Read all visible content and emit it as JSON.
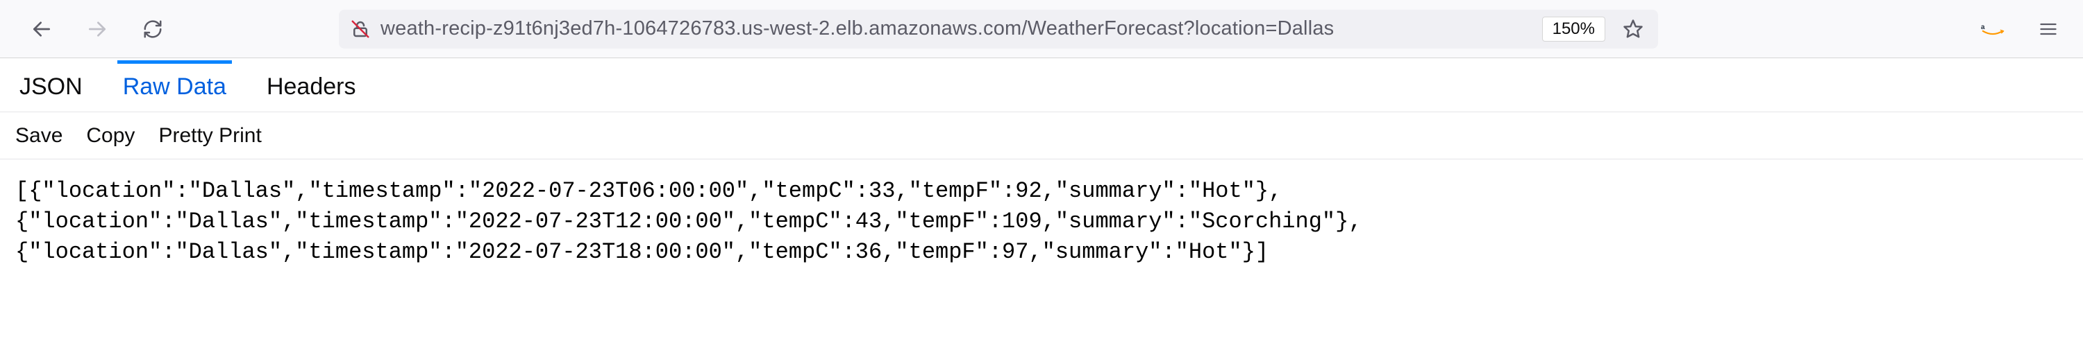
{
  "browser": {
    "url": "weath-recip-z91t6nj3ed7h-1064726783.us-west-2.elb.amazonaws.com/WeatherForecast?location=Dallas",
    "zoom": "150%"
  },
  "viewer": {
    "tabs": {
      "json": "JSON",
      "raw": "Raw Data",
      "headers": "Headers"
    },
    "actions": {
      "save": "Save",
      "copy": "Copy",
      "pretty": "Pretty Print"
    }
  },
  "raw_body": "[{\"location\":\"Dallas\",\"timestamp\":\"2022-07-23T06:00:00\",\"tempC\":33,\"tempF\":92,\"summary\":\"Hot\"},\n{\"location\":\"Dallas\",\"timestamp\":\"2022-07-23T12:00:00\",\"tempC\":43,\"tempF\":109,\"summary\":\"Scorching\"},\n{\"location\":\"Dallas\",\"timestamp\":\"2022-07-23T18:00:00\",\"tempC\":36,\"tempF\":97,\"summary\":\"Hot\"}]"
}
